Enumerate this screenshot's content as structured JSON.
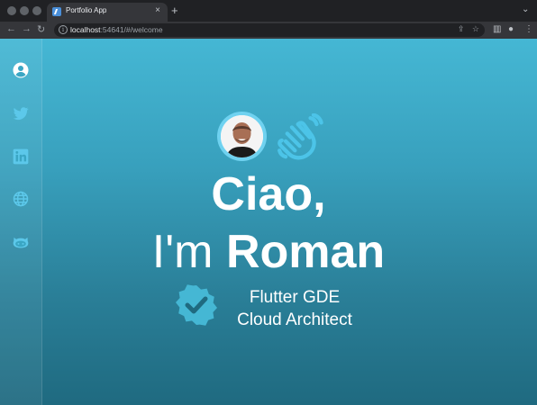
{
  "browser": {
    "tab_title": "Portfolio App",
    "tab_close": "×",
    "new_tab": "+",
    "url_host": "localhost",
    "url_rest": ":54641/#/welcome",
    "icons": [
      "back-icon",
      "forward-icon",
      "reload-icon",
      "info-icon",
      "share-icon",
      "star-icon",
      "side-panel-icon",
      "profile-icon",
      "menu-icon"
    ]
  },
  "sidebar": {
    "items": [
      {
        "icon": "profile-icon"
      },
      {
        "icon": "twitter-icon"
      },
      {
        "icon": "linkedin-icon"
      },
      {
        "icon": "globe-icon"
      },
      {
        "icon": "github-icon"
      }
    ]
  },
  "hero": {
    "greeting": "Ciao,",
    "intro_prefix": "I'm ",
    "name": "Roman",
    "role_line1": "Flutter GDE",
    "role_line2": "Cloud Architect"
  },
  "colors": {
    "accent": "#45b7d4",
    "background_bottom": "#1f6a80",
    "wave": "#4cc4e8",
    "badge": "#45b7d4"
  }
}
